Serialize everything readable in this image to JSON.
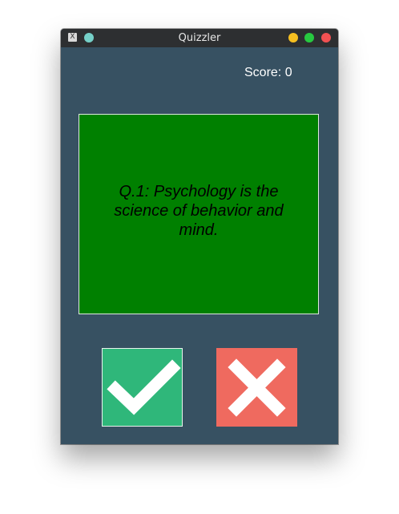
{
  "window": {
    "title": "Quizzler",
    "app_icon": "x11-icon",
    "controls": {
      "minimize_color": "#f5bf20",
      "maximize_color": "#27c940",
      "close_color": "#f15152"
    }
  },
  "score": {
    "label": "Score: 0"
  },
  "question": {
    "text": "Q.1: Psychology is the science of behavior and mind.",
    "card_color": "#008000"
  },
  "answers": {
    "true_icon": "checkmark-icon",
    "true_color": "#2fb77a",
    "false_icon": "cross-icon",
    "false_color": "#ef6a5f"
  },
  "colors": {
    "background": "#375162",
    "titlebar": "#2d2f31"
  }
}
